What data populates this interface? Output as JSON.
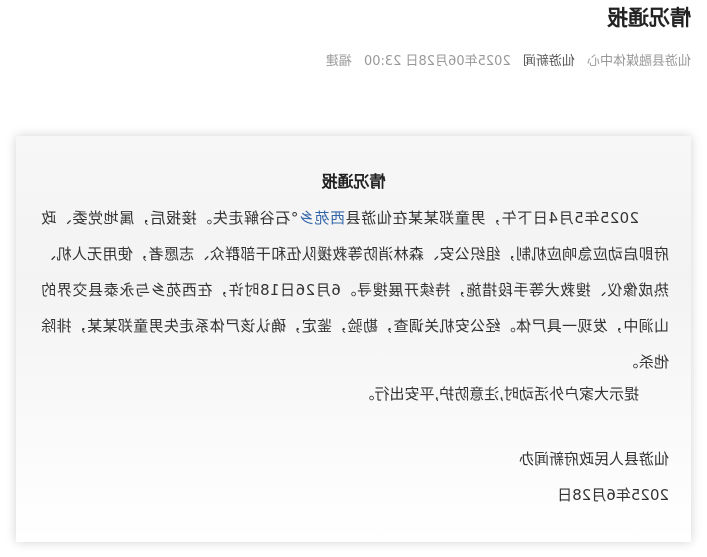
{
  "header": {
    "title": "情况通报",
    "meta": {
      "center": "仙游县融媒体中心",
      "source": "仙游新闻",
      "datetime": "2025年06月28日 23:00",
      "region": "福建"
    }
  },
  "notice": {
    "title": "情况通报",
    "body_before_link": "2025年5月4日下午，男童郑某某在仙游县",
    "link_text": "西苑乡",
    "body_after_link": "°石谷解走失。接报后，属地党委、政府即启动应急响应机制，组织公安、森林消防等救援队伍和干部群众、志愿者，使用无人机、热成像仪、搜救犬等手段措施，持续开展搜寻。6月26日18时许，在西苑乡与永泰县交界的山涧中，发现一具尸体。经公安机关调查，勘验，鉴定，确认该尸体系走失男童郑某某，排除他杀。",
    "tip": "提示大家户外活动时,注意防护,平安出行。",
    "signer": "仙游县人民政府新闻办",
    "date": "2025年6月28日"
  }
}
